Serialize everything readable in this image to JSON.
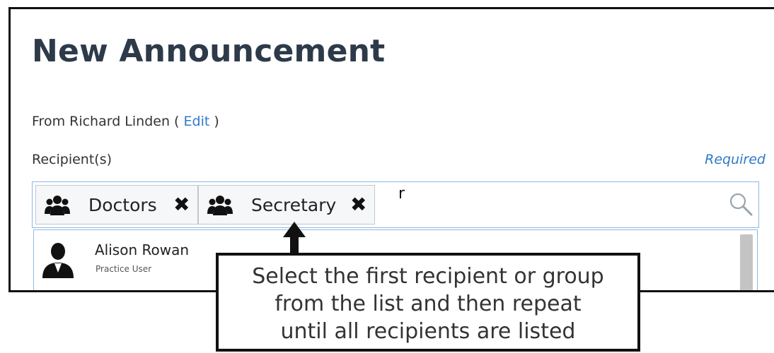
{
  "page": {
    "title": "New Announcement"
  },
  "from": {
    "prefix": "From Richard Linden",
    "open_paren": " ( ",
    "edit_link": "Edit",
    "close_paren": " )"
  },
  "recipients": {
    "label": "Recipient(s)",
    "required_label": "Required",
    "chips": [
      {
        "label": "Doctors",
        "icon": "user-group-icon",
        "remove_glyph": "✖"
      },
      {
        "label": "Secretary",
        "icon": "user-group-icon",
        "remove_glyph": "✖"
      }
    ],
    "typed_value": "r",
    "search_icon": "search-icon"
  },
  "dropdown": {
    "items": [
      {
        "name": "Alison Rowan",
        "role": "Practice User",
        "icon": "user-icon"
      }
    ]
  },
  "callout": {
    "lines": [
      "Select the first recipient or group",
      "from the list and then repeat",
      "until all recipients are listed"
    ]
  },
  "colors": {
    "link": "#2e7ac6",
    "title": "#2d3a4a",
    "input_border": "#8ab9e6"
  }
}
